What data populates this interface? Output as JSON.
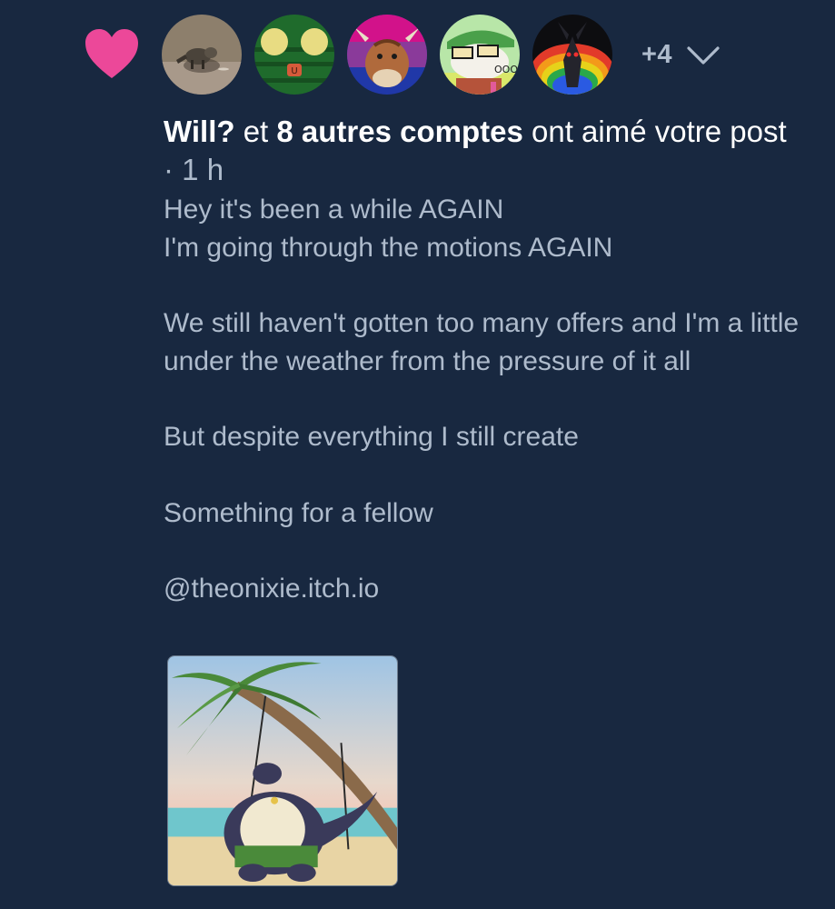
{
  "notification": {
    "type": "like",
    "icons": {
      "like": "heart-icon",
      "expand": "chevron-down-icon"
    },
    "colors": {
      "background": "#182840",
      "like_heart": "#ec4899",
      "primary_text": "#ffffff",
      "secondary_text": "#aebbcc"
    },
    "avatars": [
      {
        "name": "avatar-raccoon"
      },
      {
        "name": "avatar-frog"
      },
      {
        "name": "avatar-bull"
      },
      {
        "name": "avatar-dino"
      },
      {
        "name": "avatar-dragon"
      }
    ],
    "more_count": "+4",
    "headline": {
      "actor": "Will?",
      "connector": " et ",
      "others": "8 autres comptes",
      "action": " ont aimé votre post",
      "separator": " · ",
      "time": "1 h"
    },
    "post": {
      "lines": [
        "Hey it's been a while AGAIN",
        "I'm going through the motions AGAIN",
        "",
        "We still haven't gotten too many offers and I'm a little under the weather from the pressure of it all",
        "",
        "But despite everything I still create",
        "",
        "Something for a fellow",
        "",
        "@theonixie.itch.io"
      ]
    }
  }
}
